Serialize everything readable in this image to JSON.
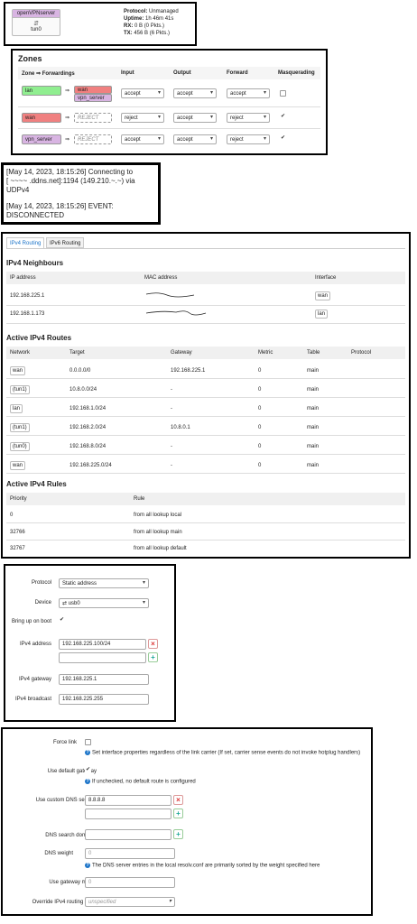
{
  "iface_status": {
    "name_badge": "openVPNserver",
    "device": "tun0",
    "protocol_label": "Protocol:",
    "protocol_value": "Unmanaged",
    "uptime_label": "Uptime:",
    "uptime_value": "1h 46m 41s",
    "rx_label": "RX:",
    "rx_value": "0 B (0 Pkts.)",
    "tx_label": "TX:",
    "tx_value": "456 B (6 Pkts.)"
  },
  "zones": {
    "title": "Zones",
    "columns": [
      "Zone ⇒ Forwardings",
      "Input",
      "Output",
      "Forward",
      "Masquerading"
    ],
    "rows": [
      {
        "zone": "lan",
        "zone_color": "#90ee90",
        "forwards": [
          "wan",
          "vpn_server"
        ],
        "input": "accept",
        "output": "accept",
        "forward": "accept",
        "masq": false
      },
      {
        "zone": "wan",
        "zone_color": "#f08080",
        "forwards": [
          "REJECT"
        ],
        "input": "reject",
        "output": "accept",
        "forward": "reject",
        "masq": true
      },
      {
        "zone": "vpn_server",
        "zone_color": "#d8b4e2",
        "forwards": [
          "REJECT"
        ],
        "input": "accept",
        "output": "accept",
        "forward": "reject",
        "masq": true
      }
    ],
    "wan_color": "#f08080",
    "vpn_color": "#d8b4e2"
  },
  "log": {
    "line1": "[May 14, 2023, 18:15:26] Connecting to",
    "line2": "[ ~~~~ .ddns.net]:1194 (149.210.~.~) via",
    "line3": "UDPv4",
    "line4": "[May 14, 2023, 18:15:26] EVENT:",
    "line5": "DISCONNECTED"
  },
  "routing": {
    "tabs": [
      "IPv4 Routing",
      "IPv6 Routing"
    ],
    "neigh_title": "IPv4 Neighbours",
    "neigh_cols": [
      "IP address",
      "MAC address",
      "Interface"
    ],
    "neighbours": [
      {
        "ip": "192.168.225.1",
        "iface": "wan"
      },
      {
        "ip": "192.168.1.173",
        "iface": "lan"
      }
    ],
    "routes_title": "Active IPv4 Routes",
    "routes_cols": [
      "Network",
      "Target",
      "Gateway",
      "Metric",
      "Table",
      "Protocol"
    ],
    "routes": [
      {
        "net": "wan",
        "target": "0.0.0.0/0",
        "gw": "192.168.225.1",
        "metric": "0",
        "table": "main"
      },
      {
        "net": "(tun1)",
        "target": "10.8.0.0/24",
        "gw": "-",
        "metric": "0",
        "table": "main"
      },
      {
        "net": "lan",
        "target": "192.168.1.0/24",
        "gw": "-",
        "metric": "0",
        "table": "main"
      },
      {
        "net": "(tun1)",
        "target": "192.168.2.0/24",
        "gw": "10.8.0.1",
        "metric": "0",
        "table": "main"
      },
      {
        "net": "(tun0)",
        "target": "192.168.8.0/24",
        "gw": "-",
        "metric": "0",
        "table": "main"
      },
      {
        "net": "wan",
        "target": "192.168.225.0/24",
        "gw": "-",
        "metric": "0",
        "table": "main"
      }
    ],
    "rules_title": "Active IPv4 Rules",
    "rules_cols": [
      "Priority",
      "Rule"
    ],
    "rules": [
      {
        "prio": "0",
        "rule": "from all lookup local"
      },
      {
        "prio": "32766",
        "rule": "from all lookup main"
      },
      {
        "prio": "32767",
        "rule": "from all lookup default"
      }
    ]
  },
  "general": {
    "protocol_label": "Protocol",
    "protocol_value": "Static address",
    "device_label": "Device",
    "device_value": "usb0",
    "boot_label": "Bring up on boot",
    "ipv4_label": "IPv4 address",
    "ipv4_value": "192.168.225.100/24",
    "gw_label": "IPv4 gateway",
    "gw_value": "192.168.225.1",
    "bcast_label": "IPv4 broadcast",
    "bcast_value": "192.168.225.255"
  },
  "advanced": {
    "force_link_label": "Force link",
    "force_link_hint": "Set interface properties regardless of the link carrier (If set, carrier sense events do not invoke hotplug handlers)",
    "default_gw_label": "Use default gateway",
    "default_gw_hint": "If unchecked, no default route is configured",
    "dns_label": "Use custom DNS servers",
    "dns_value": "8.8.8.8",
    "search_label": "DNS search domains",
    "weight_label": "DNS weight",
    "weight_placeholder": "0",
    "weight_hint": "The DNS server entries in the local resolv.conf are primarily sorted by the weight specified here",
    "metric_label": "Use gateway metric",
    "metric_placeholder": "0",
    "table_label": "Override IPv4 routing table",
    "table_value": "unspecified"
  }
}
